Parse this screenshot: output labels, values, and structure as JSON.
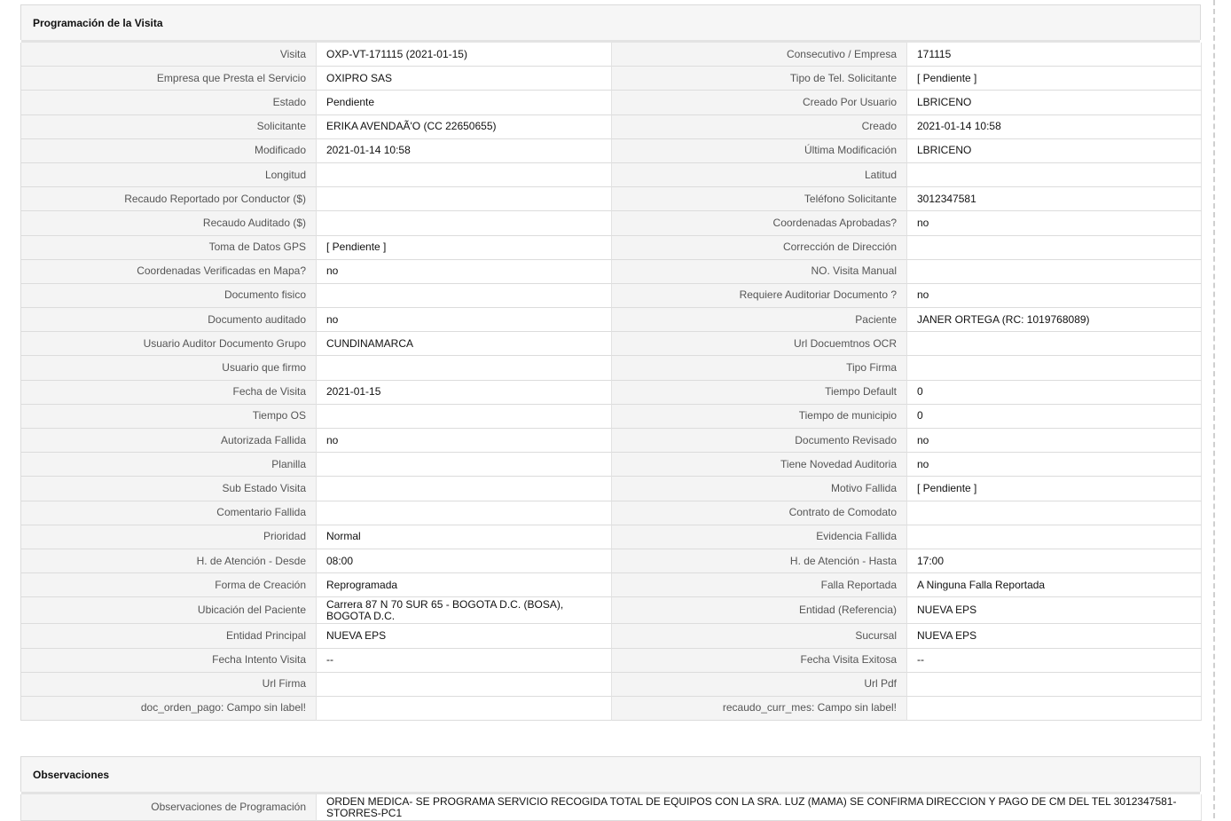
{
  "sections": {
    "programacion_title": "Programación de la Visita",
    "observaciones_title": "Observaciones"
  },
  "rows": [
    [
      {
        "label": "Visita",
        "value": "OXP-VT-171115 (2021-01-15)"
      },
      {
        "label": "Consecutivo / Empresa",
        "value": "171115"
      }
    ],
    [
      {
        "label": "Empresa que Presta el Servicio",
        "value": "OXIPRO SAS"
      },
      {
        "label": "Tipo de Tel. Solicitante",
        "value": "[ Pendiente ]"
      }
    ],
    [
      {
        "label": "Estado",
        "value": "Pendiente"
      },
      {
        "label": "Creado Por Usuario",
        "value": "LBRICENO"
      }
    ],
    [
      {
        "label": "Solicitante",
        "value": "ERIKA AVENDAÃ'O (CC 22650655)"
      },
      {
        "label": "Creado",
        "value": "2021-01-14 10:58"
      }
    ],
    [
      {
        "label": "Modificado",
        "value": "2021-01-14 10:58"
      },
      {
        "label": "Última Modificación",
        "value": " LBRICENO"
      }
    ],
    [
      {
        "label": "Longitud",
        "value": ""
      },
      {
        "label": "Latitud",
        "value": ""
      }
    ],
    [
      {
        "label": "Recaudo Reportado por Conductor ($)",
        "value": ""
      },
      {
        "label": "Teléfono Solicitante",
        "value": "3012347581"
      }
    ],
    [
      {
        "label": "Recaudo Auditado ($)",
        "value": ""
      },
      {
        "label": "Coordenadas Aprobadas?",
        "value": " no"
      }
    ],
    [
      {
        "label": "Toma de Datos GPS",
        "value": "[ Pendiente ]"
      },
      {
        "label": "Corrección de Dirección",
        "value": ""
      }
    ],
    [
      {
        "label": "Coordenadas Verificadas en Mapa?",
        "value": " no"
      },
      {
        "label": "NO. Visita Manual",
        "value": ""
      }
    ],
    [
      {
        "label": "Documento fisico",
        "value": ""
      },
      {
        "label": "Requiere Auditoriar Documento ?",
        "value": " no"
      }
    ],
    [
      {
        "label": "Documento auditado",
        "value": " no"
      },
      {
        "label": "Paciente",
        "value": "JANER ORTEGA (RC: 1019768089)"
      }
    ],
    [
      {
        "label": "Usuario Auditor Documento Grupo",
        "value": "CUNDINAMARCA"
      },
      {
        "label": "Url Docuemtnos OCR",
        "value": ""
      }
    ],
    [
      {
        "label": "Usuario que firmo",
        "value": ""
      },
      {
        "label": "Tipo Firma",
        "value": ""
      }
    ],
    [
      {
        "label": "Fecha de Visita",
        "value": " 2021-01-15"
      },
      {
        "label": "Tiempo Default",
        "value": "0"
      }
    ],
    [
      {
        "label": "Tiempo OS",
        "value": ""
      },
      {
        "label": "Tiempo de municipio",
        "value": "0"
      }
    ],
    [
      {
        "label": "Autorizada Fallida",
        "value": " no"
      },
      {
        "label": "Documento Revisado",
        "value": " no"
      }
    ],
    [
      {
        "label": "Planilla",
        "value": ""
      },
      {
        "label": "Tiene Novedad Auditoria",
        "value": " no"
      }
    ],
    [
      {
        "label": "Sub Estado Visita",
        "value": ""
      },
      {
        "label": "Motivo Fallida",
        "value": "[ Pendiente ]"
      }
    ],
    [
      {
        "label": "Comentario Fallida",
        "value": ""
      },
      {
        "label": "Contrato de Comodato",
        "value": ""
      }
    ],
    [
      {
        "label": "Prioridad",
        "value": "Normal"
      },
      {
        "label": "Evidencia Fallida",
        "value": ""
      }
    ],
    [
      {
        "label": "H. de Atención - Desde",
        "value": "08:00"
      },
      {
        "label": "H. de Atención - Hasta",
        "value": "17:00"
      }
    ],
    [
      {
        "label": "Forma de Creación",
        "value": "Reprogramada"
      },
      {
        "label": "Falla Reportada",
        "value": "A Ninguna Falla Reportada"
      }
    ],
    [
      {
        "label": "Ubicación del Paciente",
        "value": "Carrera 87 N 70 SUR 65 - BOGOTA D.C. (BOSA), BOGOTA D.C."
      },
      {
        "label": "Entidad (Referencia)",
        "value": "NUEVA EPS"
      }
    ],
    [
      {
        "label": "Entidad Principal",
        "value": "NUEVA EPS"
      },
      {
        "label": "Sucursal",
        "value": "NUEVA EPS"
      }
    ],
    [
      {
        "label": "Fecha Intento Visita",
        "value": "--"
      },
      {
        "label": "Fecha Visita Exitosa",
        "value": "--"
      }
    ],
    [
      {
        "label": "Url Firma",
        "value": ""
      },
      {
        "label": "Url Pdf",
        "value": ""
      }
    ],
    [
      {
        "label": "doc_orden_pago: Campo sin label!",
        "value": ""
      },
      {
        "label": "recaudo_curr_mes: Campo sin label!",
        "value": ""
      }
    ]
  ],
  "observaciones": {
    "label": "Observaciones de Programación",
    "value": "  ORDEN MEDICA- SE PROGRAMA SERVICIO RECOGIDA TOTAL DE EQUIPOS CON LA SRA. LUZ (MAMA) SE CONFIRMA DIRECCION Y PAGO DE CM DEL TEL 3012347581-STORRES-PC1"
  }
}
